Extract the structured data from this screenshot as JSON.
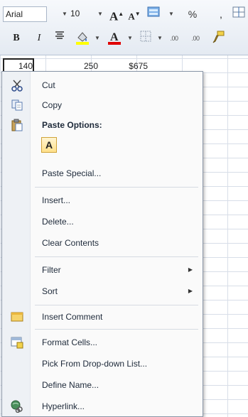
{
  "toolbar": {
    "font_name": "Arial",
    "font_size": "10",
    "grow_font_label": "A",
    "shrink_font_label": "A",
    "bold_label": "B",
    "italic_label": "I",
    "percent_label": "%",
    "comma_label": ",",
    "increase_decimal_label": ".00",
    "decrease_decimal_label": ".00"
  },
  "cells": {
    "c1": "140",
    "c2": "250",
    "c3": "$675"
  },
  "menu": {
    "cut": "Cut",
    "copy": "Copy",
    "paste_options_header": "Paste Options:",
    "paste_keep_text": "A",
    "paste_special": "Paste Special...",
    "insert": "Insert...",
    "delete": "Delete...",
    "clear_contents": "Clear Contents",
    "filter": "Filter",
    "sort": "Sort",
    "insert_comment": "Insert Comment",
    "format_cells": "Format Cells...",
    "pick_from_dropdown": "Pick From Drop-down List...",
    "define_name": "Define Name...",
    "hyperlink": "Hyperlink..."
  },
  "colors": {
    "highlight": "#ffff00",
    "font_color": "#e00000",
    "menu_bg": "#fafafa",
    "gutter": "#eef1f5"
  }
}
